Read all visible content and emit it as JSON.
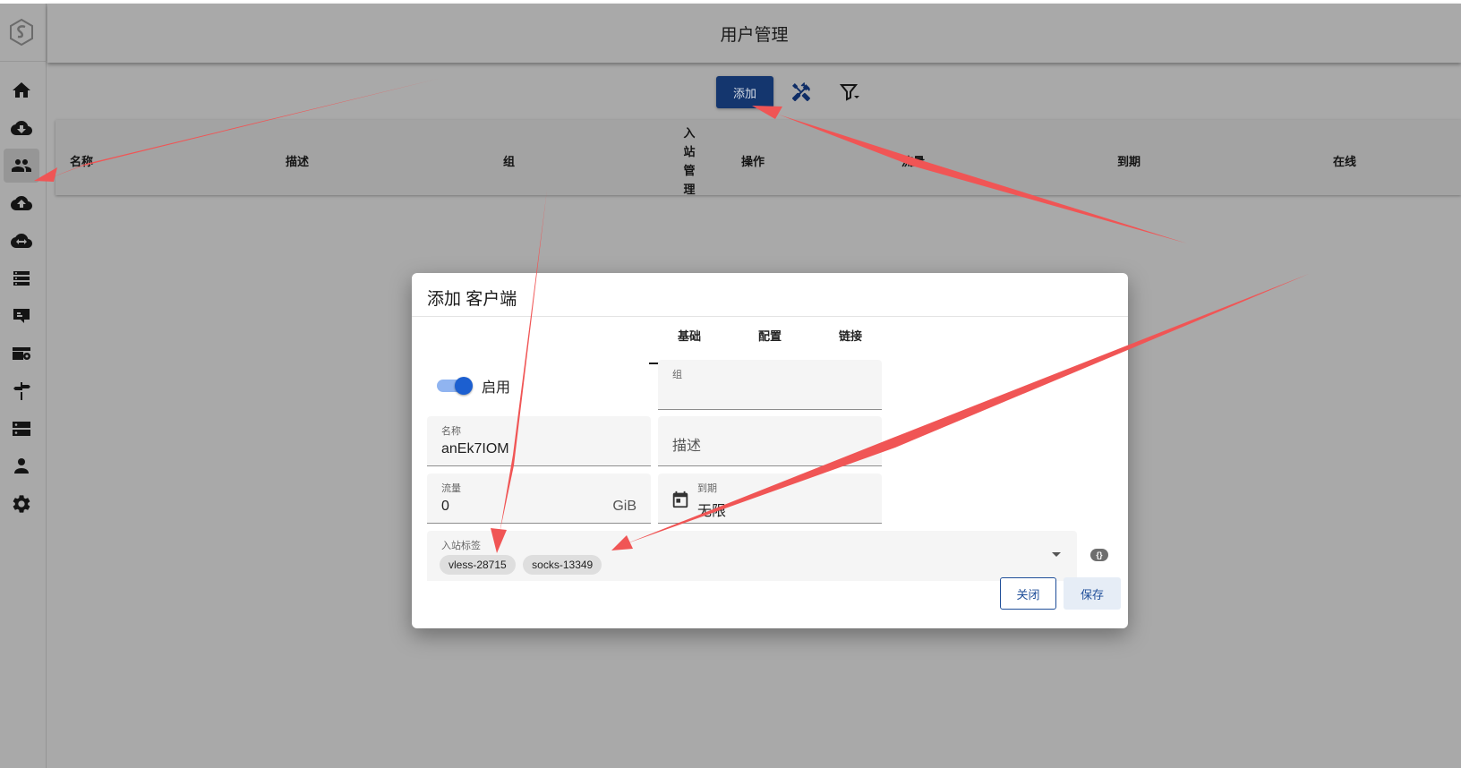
{
  "header": {
    "title": "用户管理"
  },
  "toolbar": {
    "add_label": "添加"
  },
  "table": {
    "columns": [
      "名称",
      "描述",
      "组",
      "入站管理",
      "操作",
      "流量",
      "到期",
      "在线"
    ],
    "vertical_col": [
      "入",
      "站",
      "管",
      "理"
    ]
  },
  "dialog": {
    "title": "添加 客户端",
    "tabs": [
      "基础",
      "配置",
      "链接"
    ],
    "enable_label": "启用",
    "group_label": "组",
    "name_label": "名称",
    "name_value": "anEk7IOM",
    "desc_placeholder": "描述",
    "traffic_label": "流量",
    "traffic_value": "0",
    "traffic_unit": "GiB",
    "expiry_label": "到期",
    "expiry_value": "无限",
    "inbound_tags_label": "入站标签",
    "inbound_tags": [
      "vless-28715",
      "socks-13349"
    ],
    "json_icon_text": "{}",
    "close_label": "关闭",
    "save_label": "保存"
  },
  "colors": {
    "primary": "#14366e",
    "annotation_arrow": "#f05555",
    "toggle_on": "#1c5fd0"
  },
  "icons": [
    "logo-icon",
    "home-icon",
    "cloud-download-icon",
    "users-icon",
    "cloud-upload-icon",
    "cloud-sync-icon",
    "server-list-icon",
    "inbound-icon",
    "settings-card-icon",
    "signpost-icon",
    "storage-icon",
    "admin-icon",
    "gear-icon",
    "wrench-icon",
    "filter-icon",
    "calendar-icon"
  ]
}
